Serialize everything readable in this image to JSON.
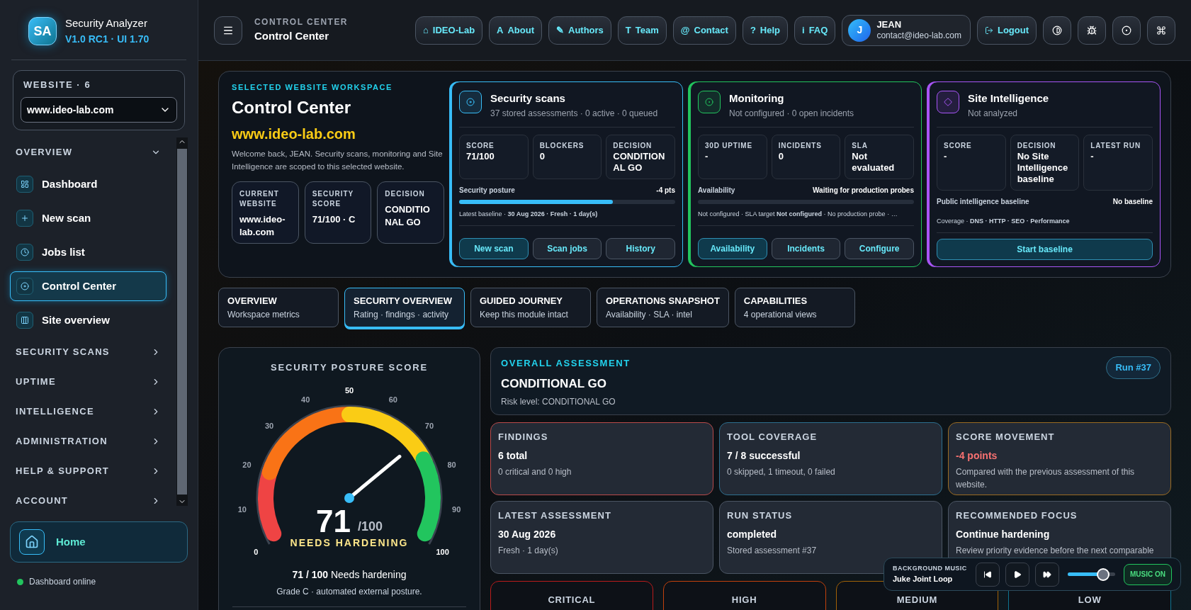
{
  "sidebar": {
    "logo": "SA",
    "title": "Security Analyzer",
    "version": "V1.0 RC1 · UI 1.70",
    "website_picker": {
      "label": "WEBSITE · 6",
      "value": "www.ideo-lab.com"
    },
    "sections": [
      {
        "label": "OVERVIEW",
        "expanded": true,
        "items": [
          {
            "label": "Dashboard",
            "selected": false
          },
          {
            "label": "New scan",
            "selected": false
          },
          {
            "label": "Jobs list",
            "selected": false
          },
          {
            "label": "Control Center",
            "selected": true
          },
          {
            "label": "Site overview",
            "selected": false
          }
        ]
      },
      {
        "label": "SECURITY SCANS",
        "expanded": false
      },
      {
        "label": "UPTIME",
        "expanded": false
      },
      {
        "label": "INTELLIGENCE",
        "expanded": false
      },
      {
        "label": "ADMINISTRATION",
        "expanded": false
      },
      {
        "label": "HELP & SUPPORT",
        "expanded": false
      },
      {
        "label": "ACCOUNT",
        "expanded": false
      }
    ],
    "home": "Home",
    "status": {
      "label": "Dashboard online",
      "online": true
    }
  },
  "topbar": {
    "eyebrow": "CONTROL CENTER",
    "title": "Control Center",
    "nav": [
      {
        "glyph": "⌂",
        "label": "IDEO-Lab"
      },
      {
        "glyph": "A",
        "label": "About"
      },
      {
        "glyph": "✎",
        "label": "Authors"
      },
      {
        "glyph": "T",
        "label": "Team"
      },
      {
        "glyph": "@",
        "label": "Contact"
      },
      {
        "glyph": "?",
        "label": "Help"
      },
      {
        "glyph": "i",
        "label": "FAQ"
      }
    ],
    "user": {
      "initial": "J",
      "name": "JEAN",
      "email": "contact@ideo-lab.com"
    },
    "logout": "Logout"
  },
  "workspace": {
    "eyebrow": "SELECTED WEBSITE WORKSPACE",
    "title": "Control Center",
    "domain": "www.ideo-lab.com",
    "welcome": "Welcome back, JEAN. Security scans, monitoring and Site Intelligence are scoped to this selected website.",
    "stats": [
      {
        "label": "CURRENT WEBSITE",
        "value": "www.ideo-lab.com"
      },
      {
        "label": "SECURITY SCORE",
        "value": "71/100 · C"
      },
      {
        "label": "DECISION",
        "value": "CONDITIONAL GO"
      }
    ],
    "modules": [
      {
        "kind": "scans",
        "color": "#38bdf8",
        "title": "Security scans",
        "subtitle": "37 stored assessments · 0 active · 0 queued",
        "metrics": [
          {
            "label": "SCORE",
            "value": "71/100"
          },
          {
            "label": "BLOCKERS",
            "value": "0"
          },
          {
            "label": "DECISION",
            "value": "CONDITIONAL GO"
          }
        ],
        "progress": {
          "label": "Security posture",
          "reading": "-4 pts",
          "level": 0.71
        },
        "footnote": "Latest baseline · **30 Aug 2026 · Fresh · 1 day(s)**",
        "buttons": [
          {
            "label": "New scan",
            "primary": true
          },
          {
            "label": "Scan jobs",
            "primary": false
          },
          {
            "label": "History",
            "primary": false
          }
        ]
      },
      {
        "kind": "monitoring",
        "color": "#22c55e",
        "title": "Monitoring",
        "subtitle": "Not configured · 0 open incidents",
        "metrics": [
          {
            "label": "30D UPTIME",
            "value": "-"
          },
          {
            "label": "INCIDENTS",
            "value": "0"
          },
          {
            "label": "SLA",
            "value": "Not evaluated"
          }
        ],
        "progress": {
          "label": "Availability",
          "reading": "Waiting for production probes"
        },
        "footnote": "Not configured · SLA target **Not configured** · No production probe · …",
        "buttons": [
          {
            "label": "Availability",
            "primary": true
          },
          {
            "label": "Incidents",
            "primary": false
          },
          {
            "label": "Configure",
            "primary": false
          }
        ]
      },
      {
        "kind": "intelligence",
        "color": "#a855f7",
        "title": "Site Intelligence",
        "subtitle": "Not analyzed",
        "metrics": [
          {
            "label": "SCORE",
            "value": "-"
          },
          {
            "label": "DECISION",
            "value": "No Site Intelligence baseline"
          },
          {
            "label": "LATEST RUN",
            "value": "-"
          }
        ],
        "progress": {
          "label": "Public intelligence baseline",
          "reading": "No baseline"
        },
        "footnote": "Coverage · **DNS · HTTP · SEO · Performance**",
        "buttons": [
          {
            "label": "Start baseline",
            "primary": true
          }
        ]
      }
    ]
  },
  "tabs": [
    {
      "title": "OVERVIEW",
      "subtitle": "Workspace metrics",
      "selected": false
    },
    {
      "title": "SECURITY OVERVIEW",
      "subtitle": "Rating · findings · activity",
      "selected": true
    },
    {
      "title": "GUIDED JOURNEY",
      "subtitle": "Keep this module intact",
      "selected": false
    },
    {
      "title": "OPERATIONS SNAPSHOT",
      "subtitle": "Availability · SLA · intel",
      "selected": false
    },
    {
      "title": "CAPABILITIES",
      "subtitle": "4 operational views",
      "selected": false
    }
  ],
  "gauge": {
    "title": "SECURITY POSTURE SCORE",
    "ticks": [
      "0",
      "10",
      "20",
      "30",
      "40",
      "50",
      "60",
      "70",
      "80",
      "90",
      "100"
    ],
    "level": 0.71,
    "score": "71",
    "out_of": "/100",
    "verdict": "NEEDS HARDENING",
    "summary": "**71 / 100** Needs hardening",
    "caption": "Grade C · automated external posture."
  },
  "assessment": {
    "eyebrow": "OVERALL ASSESSMENT",
    "title": "CONDITIONAL GO",
    "risk": "Risk level: CONDITIONAL GO",
    "run": "Run #37"
  },
  "tiles": [
    {
      "label": "FINDINGS",
      "value": "6 total",
      "detail": "0 critical and 0 high",
      "color": "#b94a4a",
      "negative": false
    },
    {
      "label": "TOOL COVERAGE",
      "value": "7 / 8 successful",
      "detail": "0 skipped, 1 timeout, 0 failed",
      "color": "#2d6f8f",
      "negative": false
    },
    {
      "label": "SCORE MOVEMENT",
      "value": "-4 points",
      "detail": "Compared with the previous assessment of this website.",
      "color": "#9a6b22",
      "negative": true
    },
    {
      "label": "LATEST ASSESSMENT",
      "value": "30 Aug 2026",
      "detail": "Fresh · 1 day(s)",
      "color": "#4b5563",
      "negative": false
    },
    {
      "label": "RUN STATUS",
      "value": "completed",
      "detail": "Stored assessment #37",
      "color": "#4b5563",
      "negative": false
    },
    {
      "label": "RECOMMENDED FOCUS",
      "value": "Continue hardening",
      "detail": "Review priority evidence before the next comparable",
      "color": "#4b5563",
      "negative": false
    }
  ],
  "severities": [
    {
      "label": "CRITICAL",
      "color": "#b91c1c"
    },
    {
      "label": "HIGH",
      "color": "#c2410c"
    },
    {
      "label": "MEDIUM",
      "color": "#a16207"
    },
    {
      "label": "LOW",
      "color": "#0e7490"
    }
  ],
  "music": {
    "label": "BACKGROUND MUSIC",
    "track": "Juke Joint Loop",
    "level": 0.75,
    "on": true,
    "toggle": "MUSIC ON"
  }
}
